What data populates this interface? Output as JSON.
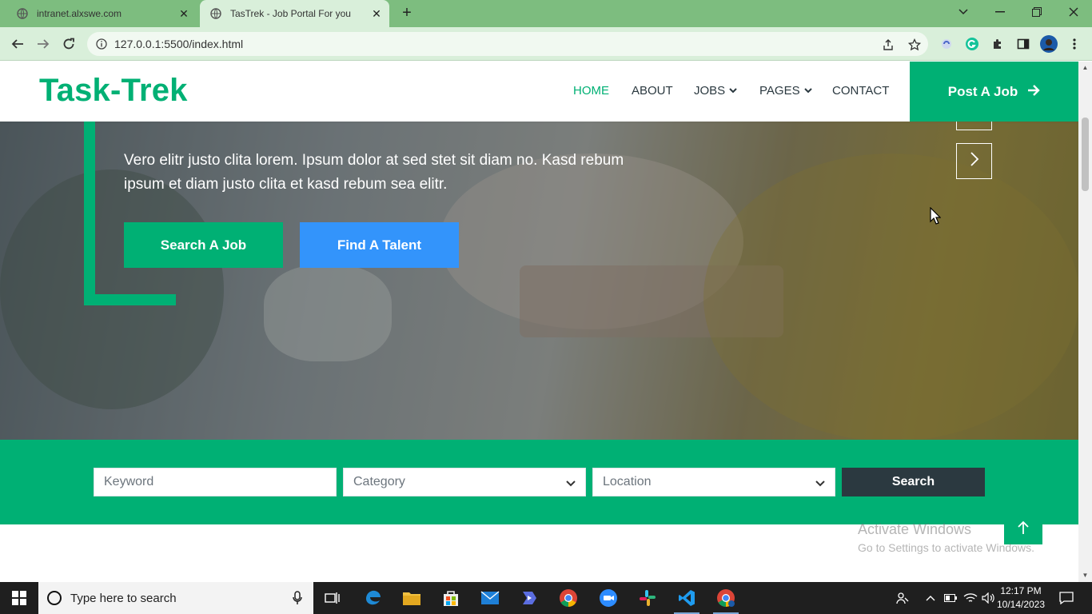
{
  "browser": {
    "tabs": [
      {
        "title": "intranet.alxswe.com",
        "active": false
      },
      {
        "title": "TasTrek - Job Portal For you",
        "active": true
      }
    ],
    "url": "127.0.0.1:5500/index.html"
  },
  "page": {
    "brand": "Task-Trek",
    "menu": [
      {
        "label": "HOME",
        "active": true,
        "dropdown": false
      },
      {
        "label": "ABOUT",
        "active": false,
        "dropdown": false
      },
      {
        "label": "JOBS",
        "active": false,
        "dropdown": true
      },
      {
        "label": "PAGES",
        "active": false,
        "dropdown": true
      },
      {
        "label": "CONTACT",
        "active": false,
        "dropdown": false
      }
    ],
    "post_job_label": "Post A Job",
    "hero": {
      "text": "Vero elitr justo clita lorem. Ipsum dolor at sed stet sit diam no. Kasd rebum ipsum et diam justo clita et kasd rebum sea elitr.",
      "search_job_label": "Search A Job",
      "find_talent_label": "Find A Talent"
    },
    "search": {
      "keyword_placeholder": "Keyword",
      "category_value": "Category",
      "location_value": "Location",
      "button_label": "Search"
    },
    "watermark": {
      "line1": "Activate Windows",
      "line2": "Go to Settings to activate Windows."
    }
  },
  "taskbar": {
    "search_placeholder": "Type here to search",
    "time": "12:17 PM",
    "date": "10/14/2023"
  },
  "colors": {
    "brand_green": "#00b074",
    "talent_blue": "#3394fb",
    "dark": "#2b3940",
    "tab_bar": "#7dbd7f"
  }
}
